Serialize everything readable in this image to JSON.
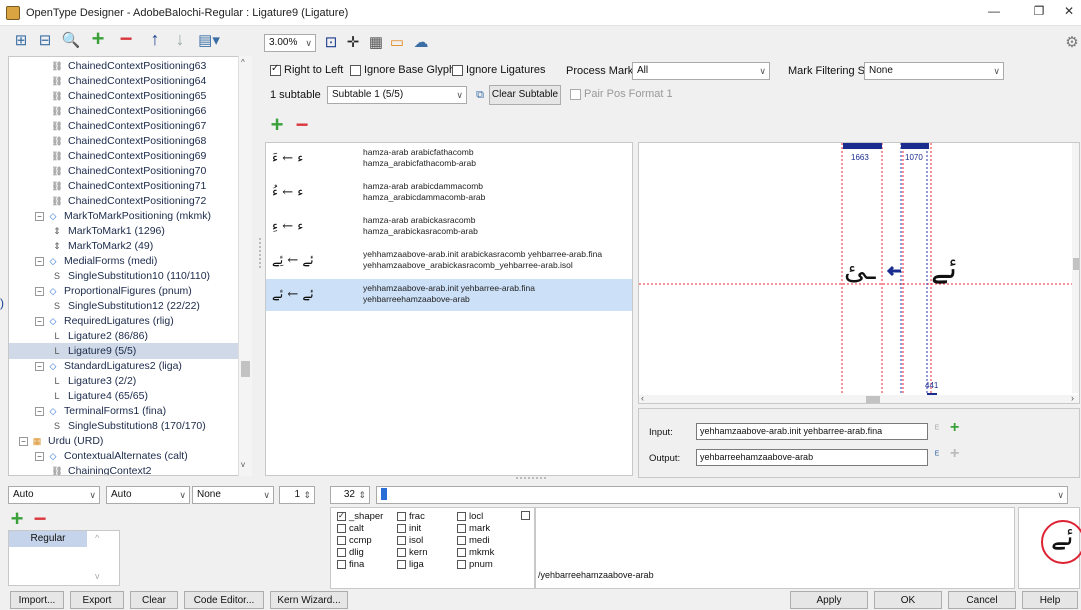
{
  "window": {
    "title": "OpenType Designer - AdobeBalochi-Regular : Ligature9 (Ligature)"
  },
  "toolbar": {
    "zoom": "3.00%"
  },
  "options": {
    "right_to_left": {
      "label": "Right to Left",
      "checked": true
    },
    "ignore_base_glyphs": {
      "label": "Ignore Base Glyphs",
      "checked": false
    },
    "ignore_ligatures": {
      "label": "Ignore Ligatures",
      "checked": false
    },
    "process_marks_label": "Process Marks:",
    "process_marks_value": "All",
    "mark_filtering_label": "Mark Filtering Set:",
    "mark_filtering_value": "None",
    "subtable_count": "1 subtable",
    "subtable_value": "Subtable 1 (5/5)",
    "clear_subtable": "Clear Subtable",
    "pair_pos_format": {
      "label": "Pair Pos Format 1",
      "checked": false
    }
  },
  "tree": [
    {
      "label": "ChainedContextPositioning63",
      "level": 2,
      "type": "chain"
    },
    {
      "label": "ChainedContextPositioning64",
      "level": 2,
      "type": "chain"
    },
    {
      "label": "ChainedContextPositioning65",
      "level": 2,
      "type": "chain"
    },
    {
      "label": "ChainedContextPositioning66",
      "level": 2,
      "type": "chain"
    },
    {
      "label": "ChainedContextPositioning67",
      "level": 2,
      "type": "chain"
    },
    {
      "label": "ChainedContextPositioning68",
      "level": 2,
      "type": "chain"
    },
    {
      "label": "ChainedContextPositioning69",
      "level": 2,
      "type": "chain"
    },
    {
      "label": "ChainedContextPositioning70",
      "level": 2,
      "type": "chain"
    },
    {
      "label": "ChainedContextPositioning71",
      "level": 2,
      "type": "chain"
    },
    {
      "label": "ChainedContextPositioning72",
      "level": 2,
      "type": "chain"
    },
    {
      "label": "MarkToMarkPositioning (mkmk)",
      "level": 1,
      "type": "feature"
    },
    {
      "label": "MarkToMark1 (1296)",
      "level": 2,
      "type": "mark"
    },
    {
      "label": "MarkToMark2 (49)",
      "level": 2,
      "type": "mark"
    },
    {
      "label": "MedialForms (medi)",
      "level": 1,
      "type": "feature"
    },
    {
      "label": "SingleSubstitution10 (110/110)",
      "level": 2,
      "type": "single"
    },
    {
      "label": "ProportionalFigures (pnum)",
      "level": 1,
      "type": "feature"
    },
    {
      "label": "SingleSubstitution12 (22/22)",
      "level": 2,
      "type": "single"
    },
    {
      "label": "RequiredLigatures (rlig)",
      "level": 1,
      "type": "feature"
    },
    {
      "label": "Ligature2 (86/86)",
      "level": 2,
      "type": "lig"
    },
    {
      "label": "Ligature9 (5/5)",
      "level": 2,
      "type": "lig",
      "selected": true
    },
    {
      "label": "StandardLigatures2 (liga)",
      "level": 1,
      "type": "feature"
    },
    {
      "label": "Ligature3 (2/2)",
      "level": 2,
      "type": "lig"
    },
    {
      "label": "Ligature4 (65/65)",
      "level": 2,
      "type": "lig"
    },
    {
      "label": "TerminalForms1 (fina)",
      "level": 1,
      "type": "feature"
    },
    {
      "label": "SingleSubstitution8 (170/170)",
      "level": 2,
      "type": "single"
    },
    {
      "label": "Urdu (URD)",
      "level": 0,
      "type": "lang"
    },
    {
      "label": "ContextualAlternates (calt)",
      "level": 1,
      "type": "feature"
    },
    {
      "label": "ChainingContext2",
      "level": 2,
      "type": "chain"
    }
  ],
  "rules": [
    {
      "line1": "hamza-arab arabicfathacomb",
      "line2": "hamza_arabicfathacomb-arab",
      "glyph": "ء ← ءَ"
    },
    {
      "line1": "hamza-arab arabicdammacomb",
      "line2": "hamza_arabicdammacomb-arab",
      "glyph": "ء ← ءُ"
    },
    {
      "line1": "hamza-arab arabickasracomb",
      "line2": "hamza_arabickasracomb-arab",
      "glyph": "ء ← ءِ"
    },
    {
      "line1": "yehhamzaabove-arab.init arabickasracomb yehbarree-arab.fina",
      "line2": "yehhamzaabove_arabickasracomb_yehbarree-arab.isol",
      "glyph": "ئے ← ئِے"
    },
    {
      "line1": "yehhamzaabove-arab.init yehbarree-arab.fina",
      "line2": "yehbarreehamzaabove-arab",
      "glyph": "ئے ← ئے",
      "selected": true
    }
  ],
  "preview": {
    "adv1": "1663",
    "adv2": "1070",
    "bottom_value": "441",
    "glyph_left": "ـئ",
    "glyph_right": "ئے"
  },
  "io": {
    "input_label": "Input:",
    "input_value": "yehhamzaabove-arab.init yehbarree-arab.fina",
    "output_label": "Output:",
    "output_value": "yehbarreehamzaabove-arab"
  },
  "bottom": {
    "combo1": "Auto",
    "combo2": "Auto",
    "combo3": "None",
    "spin1": "1",
    "spin2": "32",
    "style": "Regular",
    "glyph_path": "/yehbarreehamzaabove-arab",
    "big_glyph": "ئے"
  },
  "features": [
    {
      "label": "_shaper",
      "checked": true
    },
    {
      "label": "frac",
      "checked": false
    },
    {
      "label": "locl",
      "checked": false
    },
    {
      "label": "calt",
      "checked": false
    },
    {
      "label": "init",
      "checked": false
    },
    {
      "label": "mark",
      "checked": false
    },
    {
      "label": "ccmp",
      "checked": false
    },
    {
      "label": "isol",
      "checked": false
    },
    {
      "label": "medi",
      "checked": false
    },
    {
      "label": "dlig",
      "checked": false
    },
    {
      "label": "kern",
      "checked": false
    },
    {
      "label": "mkmk",
      "checked": false
    },
    {
      "label": "fina",
      "checked": false
    },
    {
      "label": "liga",
      "checked": false
    },
    {
      "label": "pnum",
      "checked": false
    }
  ],
  "buttons": {
    "import": "Import...",
    "export": "Export",
    "clear": "Clear",
    "code_editor": "Code Editor...",
    "kern_wizard": "Kern Wizard...",
    "apply": "Apply",
    "ok": "OK",
    "cancel": "Cancel",
    "help": "Help"
  },
  "colors": {
    "accent": "#1a3d8f",
    "selection": "#cce0f7",
    "plus": "#3aa13a",
    "minus": "#d9363e"
  }
}
